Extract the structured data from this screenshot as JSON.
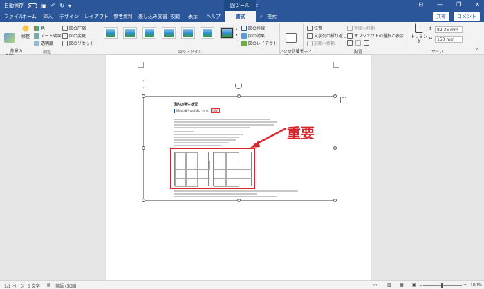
{
  "titlebar": {
    "autosave_label": "自動保存",
    "autosave_state": "オフ",
    "doc_title": "文書 1 - Word",
    "context_tab": "図ツール",
    "save_icon": "save-icon",
    "undo_icon": "undo-icon",
    "redo_icon": "redo-icon"
  },
  "tabs": [
    {
      "label": "ファイル"
    },
    {
      "label": "ホーム"
    },
    {
      "label": "挿入"
    },
    {
      "label": "デザイン"
    },
    {
      "label": "レイアウト"
    },
    {
      "label": "参考資料"
    },
    {
      "label": "差し込み文書"
    },
    {
      "label": "校閲"
    },
    {
      "label": "表示"
    },
    {
      "label": "ヘルプ"
    },
    {
      "label": "書式"
    },
    {
      "label": "検索"
    }
  ],
  "share": {
    "share_label": "共有",
    "comment_label": "コメント"
  },
  "ribbon": {
    "adjust": {
      "remove_bg": "背景の\n削除",
      "corrections": "修整",
      "color": "色",
      "artistic": "アート効果",
      "transparency": "透明度",
      "compress": "図の圧縮",
      "change": "図の変更",
      "reset": "図のリセット",
      "label": "調整"
    },
    "styles": {
      "border": "図の枠線",
      "effects": "図の効果",
      "layout": "図のレイアウト",
      "label": "図のスタイル"
    },
    "accessibility": {
      "alt_text": "代替テ\nキスト",
      "label": "アクセシビリティ"
    },
    "arrange": {
      "position": "位置",
      "wrap_text": "文字列の折り返し",
      "bring_forward": "前面へ移動",
      "send_backward": "背面へ移動",
      "selection_pane": "オブジェクトの選択と表示",
      "label": "配置"
    },
    "size": {
      "crop": "トリミング",
      "height": "82.36 mm",
      "width": "150 mm",
      "label": "サイズ"
    }
  },
  "document": {
    "page_title": "国内の発生状況",
    "section_heading": "国内の発生の状況について",
    "new_badge": "NEW",
    "annotation": "重要"
  },
  "status": {
    "page": "1/1 ページ",
    "words": "0 文字",
    "language": "英語 (米国)",
    "zoom": "100%"
  }
}
